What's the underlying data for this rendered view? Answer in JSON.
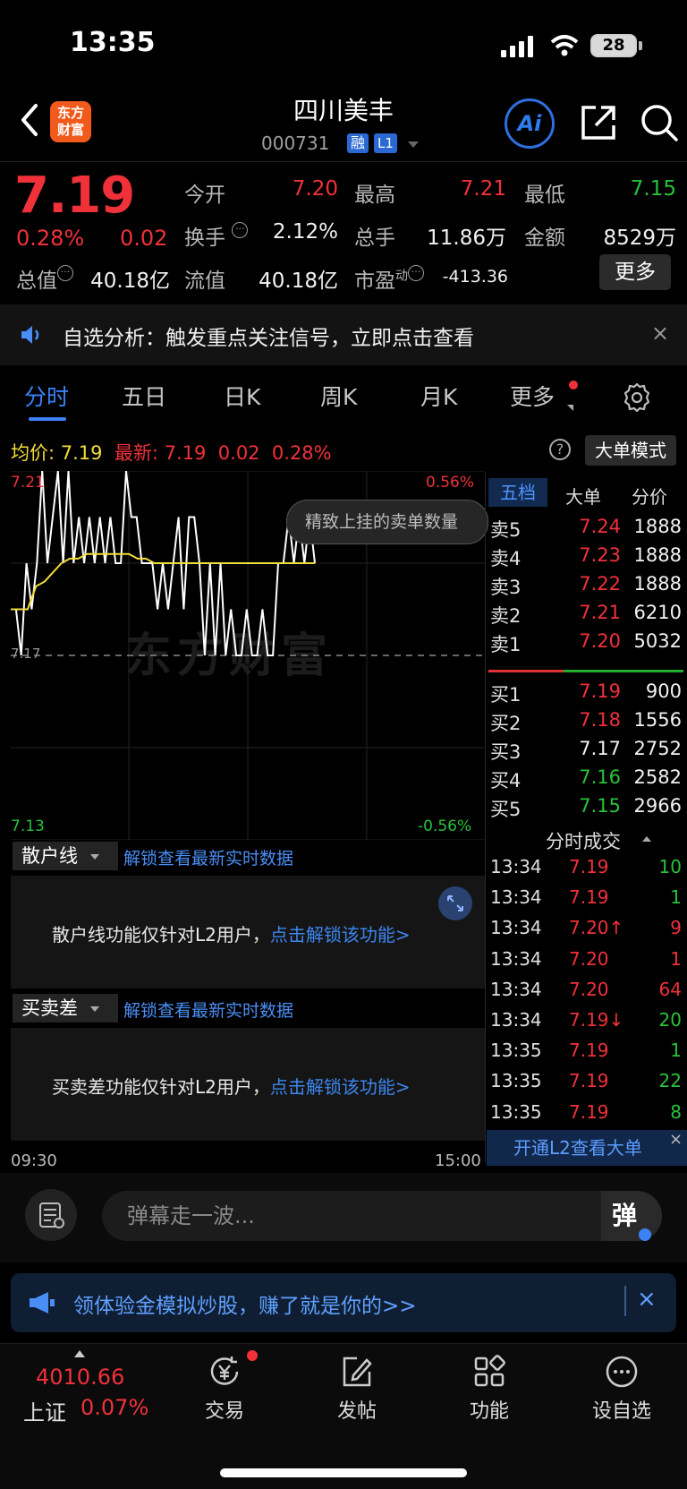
{
  "status_bar": {
    "time": "13:35",
    "battery": "28"
  },
  "header": {
    "logo_line1": "东方",
    "logo_line2": "财富",
    "stock_name": "四川美丰",
    "stock_code": "000731",
    "tag_rong": "融",
    "tag_l1": "L1",
    "ai_label": "Ai"
  },
  "quote": {
    "price": "7.19",
    "change_pct": "0.28%",
    "change_amt": "0.02",
    "open_label": "今开",
    "open": "7.20",
    "high_label": "最高",
    "high": "7.21",
    "low_label": "最低",
    "low": "7.15",
    "turnover_label": "换手",
    "turnover": "2.12%",
    "volume_label": "总手",
    "volume": "11.86万",
    "amount_label": "金额",
    "amount": "8529万",
    "mktcap_label": "总值",
    "mktcap": "40.18亿",
    "float_label": "流值",
    "float": "40.18亿",
    "pe_label": "市盈",
    "pe_sup": "动",
    "pe": "-413.36",
    "more_label": "更多"
  },
  "notice": {
    "text": "自选分析：触发重点关注信号，立即点击查看",
    "close": "×"
  },
  "tabs": [
    "分时",
    "五日",
    "日K",
    "周K",
    "月K",
    "更多"
  ],
  "chart_info": {
    "avg_label": "均价:",
    "avg": "7.19",
    "latest_label": "最新:",
    "latest": "7.19",
    "change": "0.02",
    "change_pct": "0.28%",
    "help": "?",
    "mode_button": "大单模式"
  },
  "chart_data": {
    "type": "line",
    "title": "",
    "xlabel": "",
    "ylabel": "",
    "x_range": [
      "09:30",
      "15:00"
    ],
    "ylim": [
      7.13,
      7.21
    ],
    "y_ticks_left": [
      "7.21",
      "7.17",
      "7.13"
    ],
    "y_ticks_right": [
      "0.56%",
      "-0.56%"
    ],
    "baseline": 7.17,
    "series": [
      {
        "values": [
          7.18,
          7.18,
          7.17,
          7.19,
          7.18,
          7.19,
          7.21,
          7.19,
          7.2,
          7.21,
          7.19,
          7.21,
          7.19,
          7.2,
          7.19,
          7.2,
          7.19,
          7.2,
          7.19,
          7.2,
          7.19,
          7.19,
          7.21,
          7.2,
          7.2,
          7.19,
          7.19,
          7.19,
          7.18,
          7.19,
          7.18,
          7.19,
          7.2,
          7.18,
          7.2,
          7.2,
          7.19,
          7.17,
          7.19,
          7.17,
          7.19,
          7.17,
          7.18,
          7.17,
          7.17,
          7.18,
          7.17,
          7.17,
          7.18,
          7.17,
          7.17,
          7.19,
          7.19,
          7.2,
          7.19,
          7.2,
          7.19,
          7.2,
          7.19
        ]
      },
      {
        "values": [
          7.18,
          7.18,
          7.18,
          7.185,
          7.186,
          7.188,
          7.19,
          7.191,
          7.191,
          7.192,
          7.192,
          7.192,
          7.192,
          7.192,
          7.192,
          7.191,
          7.191,
          7.19,
          7.19,
          7.19,
          7.19,
          7.19,
          7.19,
          7.19,
          7.19,
          7.19,
          7.19,
          7.19,
          7.19,
          7.19,
          7.19,
          7.19,
          7.19,
          7.19,
          7.19,
          7.19,
          7.19
        ]
      }
    ],
    "watermark": "东方财富",
    "tooltip": "精致上挂的卖单数量"
  },
  "indicators": [
    {
      "name": "散户线",
      "link": "解锁查看最新实时数据",
      "msg": "散户线功能仅针对L2用户，",
      "cta": "点击解锁该功能>"
    },
    {
      "name": "买卖差",
      "link": "解锁查看最新实时数据",
      "msg": "买卖差功能仅针对L2用户，",
      "cta": "点击解锁该功能>"
    }
  ],
  "time_axis": {
    "start": "09:30",
    "end": "15:00"
  },
  "order_book": {
    "tabs": [
      "五档",
      "大单",
      "分价"
    ],
    "asks": [
      {
        "label": "卖5",
        "price": "7.24",
        "vol": "1888",
        "color": "#f0313a"
      },
      {
        "label": "卖4",
        "price": "7.23",
        "vol": "1888",
        "color": "#f0313a"
      },
      {
        "label": "卖3",
        "price": "7.22",
        "vol": "1888",
        "color": "#f0313a"
      },
      {
        "label": "卖2",
        "price": "7.21",
        "vol": "6210",
        "color": "#f0313a"
      },
      {
        "label": "卖1",
        "price": "7.20",
        "vol": "5032",
        "color": "#f0313a"
      }
    ],
    "bids": [
      {
        "label": "买1",
        "price": "7.19",
        "vol": "900",
        "color": "#f0313a"
      },
      {
        "label": "买2",
        "price": "7.18",
        "vol": "1556",
        "color": "#f0313a"
      },
      {
        "label": "买3",
        "price": "7.17",
        "vol": "2752",
        "color": "#f2f2f2"
      },
      {
        "label": "买4",
        "price": "7.16",
        "vol": "2582",
        "color": "#28c23a"
      },
      {
        "label": "买5",
        "price": "7.15",
        "vol": "2966",
        "color": "#28c23a"
      }
    ]
  },
  "trades": {
    "title": "分时成交",
    "rows": [
      {
        "time": "13:34",
        "price": "7.19",
        "vol": "10",
        "pc": "#f0313a",
        "vc": "#28c23a"
      },
      {
        "time": "13:34",
        "price": "7.19",
        "vol": "1",
        "pc": "#f0313a",
        "vc": "#28c23a"
      },
      {
        "time": "13:34",
        "price": "7.20↑",
        "vol": "9",
        "pc": "#f0313a",
        "vc": "#f0313a"
      },
      {
        "time": "13:34",
        "price": "7.20",
        "vol": "1",
        "pc": "#f0313a",
        "vc": "#f0313a"
      },
      {
        "time": "13:34",
        "price": "7.20",
        "vol": "64",
        "pc": "#f0313a",
        "vc": "#f0313a"
      },
      {
        "time": "13:34",
        "price": "7.19↓",
        "vol": "20",
        "pc": "#f0313a",
        "vc": "#28c23a"
      },
      {
        "time": "13:35",
        "price": "7.19",
        "vol": "1",
        "pc": "#f0313a",
        "vc": "#28c23a"
      },
      {
        "time": "13:35",
        "price": "7.19",
        "vol": "22",
        "pc": "#f0313a",
        "vc": "#28c23a"
      },
      {
        "time": "13:35",
        "price": "7.19",
        "vol": "8",
        "pc": "#f0313a",
        "vc": "#28c23a"
      }
    ],
    "l2_banner": "开通L2查看大单",
    "close": "×"
  },
  "comment": {
    "placeholder": "弹幕走一波...",
    "button": "弹"
  },
  "promo": {
    "text": "领体验金模拟炒股，赚了就是你的>>",
    "close": "×"
  },
  "bottom_nav": {
    "index_value": "4010.66",
    "index_name": "上证",
    "index_pct": "0.07%",
    "items": [
      "交易",
      "发帖",
      "功能",
      "设自选"
    ]
  }
}
